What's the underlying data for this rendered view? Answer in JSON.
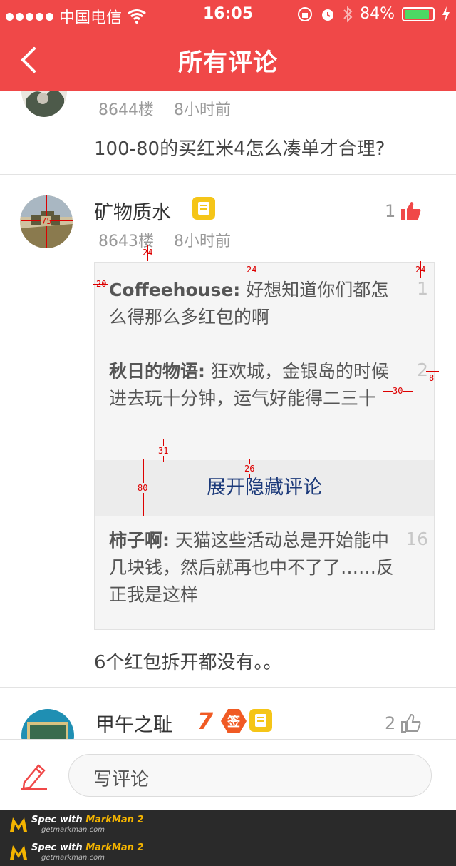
{
  "status_bar": {
    "carrier": "中国电信",
    "time": "16:05",
    "battery": "84%",
    "battery_level": 0.84
  },
  "nav": {
    "title": "所有评论"
  },
  "colors": {
    "brand": "#f04848",
    "link": "#1c3a7a",
    "badge_yellow": "#f5c518",
    "badge_orange": "#f05a24"
  },
  "comments": [
    {
      "floor": "8644楼",
      "time": "8小时前",
      "text": "100-80的买红米4怎么凑单才合理?"
    },
    {
      "name": "矿物质水",
      "floor": "8643楼",
      "time": "8小时前",
      "likes": "1",
      "replies": [
        {
          "author": "Coffeehouse:",
          "text": " 好想知道你们都怎么得那么多红包的啊",
          "floor": "1"
        },
        {
          "author": "秋日的物语:",
          "text": " 狂欢城，金银岛的时候进去玩十分钟，运气好能得二三十",
          "floor": "2"
        },
        {
          "author": "柿子啊:",
          "text": " 天猫这些活动总是开始能中几块钱，然后就再也中不了了……反正我是这样",
          "floor": "16"
        }
      ],
      "expand_label": "展开隐藏评论",
      "text": "6个红包拆开都没有。。"
    },
    {
      "name": "甲午之耻",
      "likes": "2",
      "badge_seven": "7",
      "badge_sign": "签"
    }
  ],
  "annotations": {
    "avatar_size": "75",
    "a24": "24",
    "b24": "24",
    "c24": "24",
    "a20": "20",
    "a8": "8",
    "a30": "30",
    "a31": "31",
    "a26": "26",
    "a80": "80"
  },
  "composer": {
    "placeholder": "写评论"
  },
  "markman": {
    "line1_prefix": "Spec with ",
    "line1_brand": "MarkMan 2",
    "line2": "getmarkman.com"
  }
}
